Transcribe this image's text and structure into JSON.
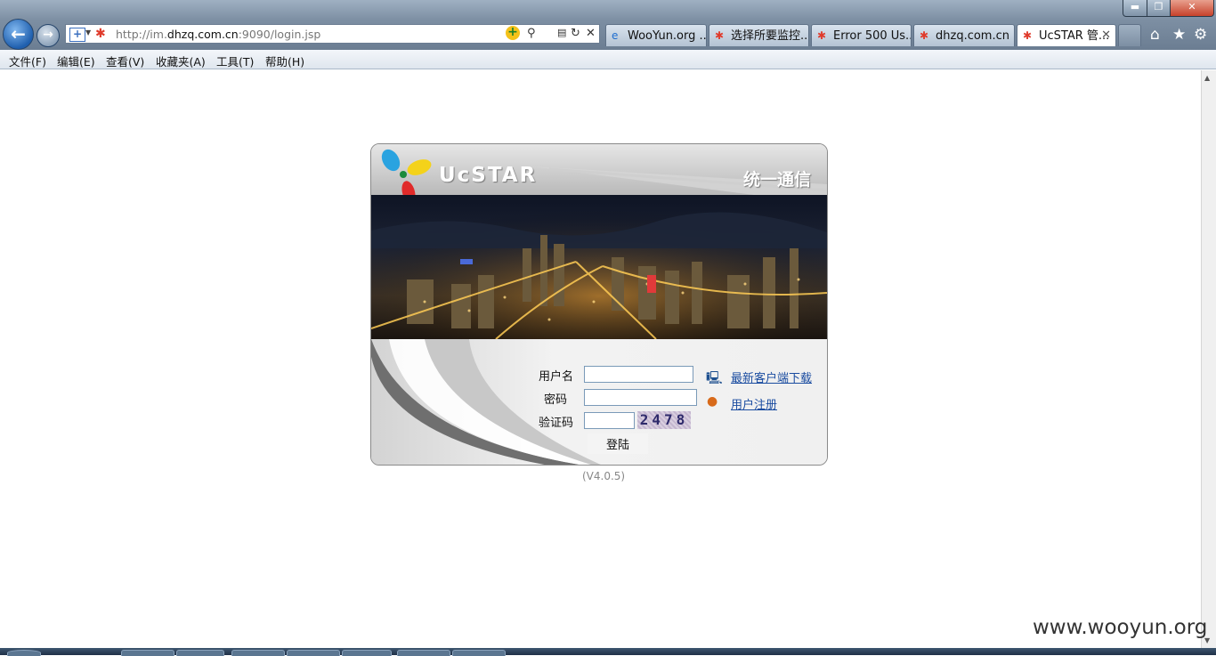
{
  "browser": {
    "address": {
      "url_prefix": "http://im.",
      "url_domain": "dhzq.com.cn",
      "url_suffix": ":9090/login.jsp"
    },
    "tabs": [
      {
        "label": "WooYun.org ...",
        "icon": "ie-icon"
      },
      {
        "label": "选择所要监控...",
        "icon": "ucstar-favicon"
      },
      {
        "label": "Error 500 Us...",
        "icon": "ucstar-favicon"
      },
      {
        "label": "dhzq.com.cn",
        "icon": "ucstar-favicon"
      },
      {
        "label": "UcSTAR 管...",
        "icon": "ucstar-favicon",
        "active": true
      }
    ],
    "window_buttons": {
      "minimize": "▬",
      "maximize": "❐",
      "close": "✕"
    }
  },
  "menu": {
    "items": [
      "文件(F)",
      "编辑(E)",
      "查看(V)",
      "收藏夹(A)",
      "工具(T)",
      "帮助(H)"
    ]
  },
  "login": {
    "brand_name": "UcSTAR",
    "brand_slogan": "统一通信",
    "username_label": "用户名",
    "password_label": "密码",
    "captcha_label": "验证码",
    "username_value": "",
    "password_value": "",
    "captcha_value": "",
    "captcha_text": "2478",
    "submit_label": "登陆",
    "download_link": "最新客户端下载",
    "register_link": "用户注册",
    "version": "(V4.0.5)"
  },
  "watermark": "www.wooyun.org",
  "colors": {
    "link": "#1a4ca0",
    "accent": "#1f5fae"
  }
}
